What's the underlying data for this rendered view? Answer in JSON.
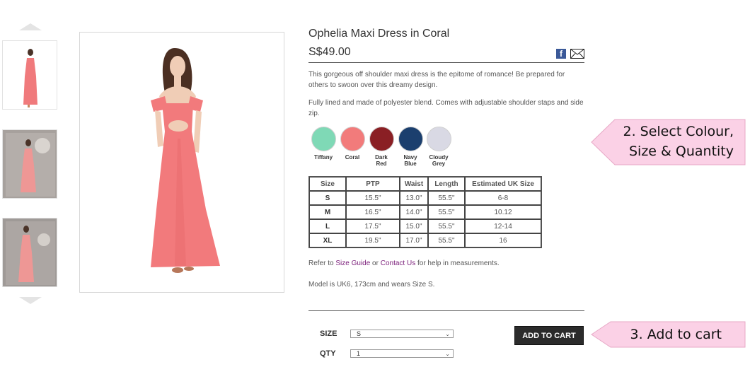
{
  "product": {
    "title": "Ophelia Maxi Dress in Coral",
    "price": "S$49.00",
    "description_1": "This gorgeous off shoulder maxi dress is the epitome of romance! Be prepared for others to swoon over this dreamy design.",
    "description_2": "Fully lined and made of polyester blend. Comes with adjustable shoulder staps and side zip."
  },
  "share": {
    "facebook_glyph": "f",
    "facebook_icon": "facebook-icon",
    "email_icon": "email-icon"
  },
  "colours": [
    {
      "name": "Tiffany",
      "name_line2": "",
      "hex": "#7fd9b6"
    },
    {
      "name": "Coral",
      "name_line2": "",
      "hex": "#f27b7b"
    },
    {
      "name": "Dark",
      "name_line2": "Red",
      "hex": "#8a1f24"
    },
    {
      "name": "Navy",
      "name_line2": "Blue",
      "hex": "#1b3f6e"
    },
    {
      "name": "Cloudy",
      "name_line2": "Grey",
      "hex": "#d9d9e4"
    }
  ],
  "size_table": {
    "headers": [
      "Size",
      "PTP",
      "Waist",
      "Length",
      "Estimated UK Size"
    ],
    "rows": [
      [
        "S",
        "15.5\"",
        "13.0\"",
        "55.5\"",
        "6-8"
      ],
      [
        "M",
        "16.5\"",
        "14.0\"",
        "55.5\"",
        "10.12"
      ],
      [
        "L",
        "17.5\"",
        "15.0\"",
        "55.5\"",
        "12-14"
      ],
      [
        "XL",
        "19.5\"",
        "17.0\"",
        "55.5\"",
        "16"
      ]
    ]
  },
  "help": {
    "prefix": "Refer to ",
    "size_guide": "Size Guide",
    "middle": " or ",
    "contact_us": "Contact Us",
    "suffix": " for help in measurements."
  },
  "model_note": "Model is UK6, 173cm and wears Size S.",
  "purchase": {
    "size_label": "SIZE",
    "size_value": "S",
    "qty_label": "QTY",
    "qty_value": "1",
    "add_to_cart": "ADD TO CART"
  },
  "callouts": {
    "step2_line1": "2. Select Colour,",
    "step2_line2": "Size & Quantity",
    "step3": "3. Add to cart"
  },
  "colors": {
    "dress": "#f07a7c",
    "callout_bg": "#fbd1e6",
    "button": "#2b2b2b",
    "link": "#7b1e7a"
  }
}
